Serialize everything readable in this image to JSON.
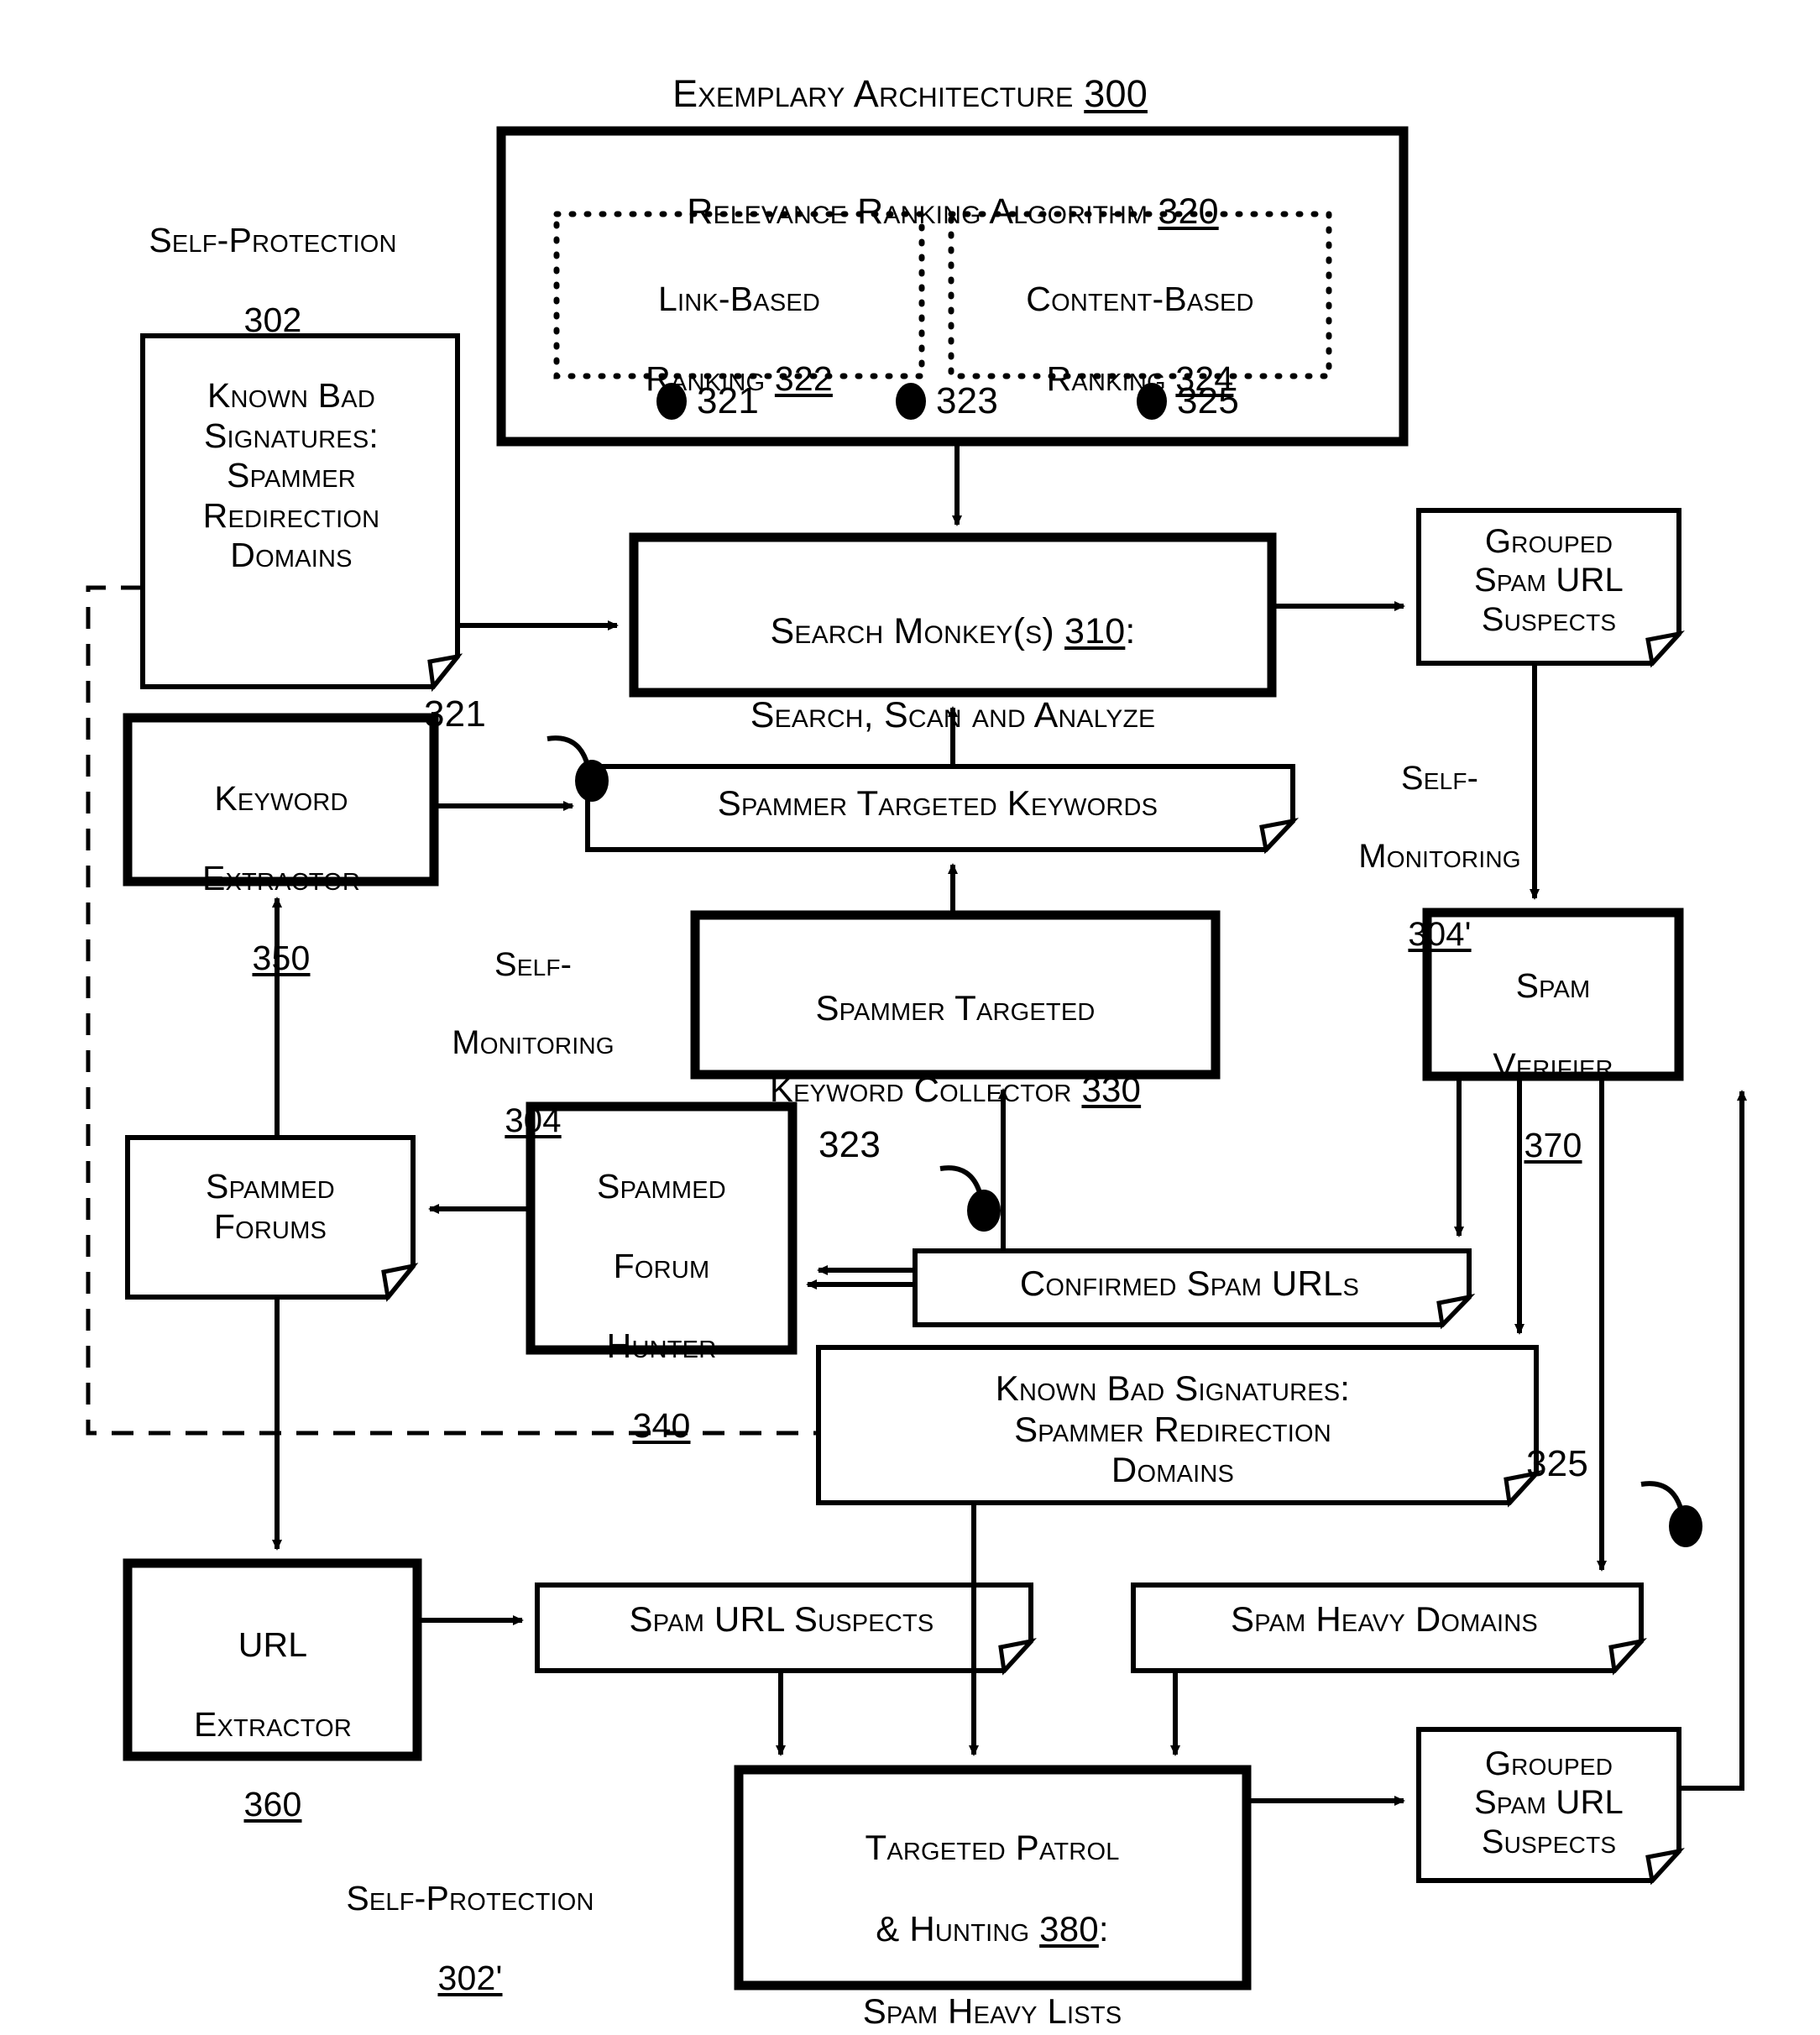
{
  "figure": {
    "title_text": "Exemplary Architecture ",
    "title_ref": "300"
  },
  "annotations": {
    "self_protection_top": {
      "line1": "Self-Protection",
      "ref": "302"
    },
    "self_protection_bottom": {
      "line1": "Self-Protection",
      "ref": "302'"
    },
    "self_monitoring_left": {
      "line1": "Self-",
      "line2": "Monitoring",
      "ref": "304"
    },
    "self_monitoring_right": {
      "line1": "Self-",
      "line2": "Monitoring",
      "ref": "304'"
    },
    "callout_321": "321",
    "callout_323": "323",
    "callout_325": "325"
  },
  "blocks": {
    "relevance_ranking": {
      "title": "Relevance Ranking Algorithm ",
      "ref": "320"
    },
    "link_based": {
      "line1": "Link-Based",
      "line2": "Ranking ",
      "ref": "322"
    },
    "content_based": {
      "line1": "Content-Based",
      "line2": "Ranking ",
      "ref": "324"
    },
    "bullets": [
      {
        "label": "321"
      },
      {
        "label": "323"
      },
      {
        "label": "325"
      }
    ],
    "known_bad_signatures_top": {
      "text": "Known Bad\nSignatures:\nSpammer\nRedirection\nDomains"
    },
    "search_monkey": {
      "line1a": "Search Monkey(s) ",
      "ref": "310",
      "line1b": ":",
      "line2": "Search, Scan and Analyze"
    },
    "grouped_spam_url_suspects_top": {
      "text": "Grouped\nSpam URL\nSuspects"
    },
    "keyword_extractor": {
      "line1": "Keyword",
      "line2": "Extractor",
      "ref": "350"
    },
    "spammer_targeted_keywords": {
      "text": "Spammer Targeted Keywords"
    },
    "spam_verifier": {
      "line1": "Spam",
      "line2": "Verifier",
      "ref": "370"
    },
    "spammer_targeted_keyword_collector": {
      "line1": "Spammer Targeted",
      "line2a": "Keyword Collector ",
      "ref": "330"
    },
    "spammed_forums": {
      "text": "Spammed\nForums"
    },
    "spammed_forum_hunter": {
      "line1": "Spammed",
      "line2": "Forum",
      "line3": "Hunter",
      "ref": "340"
    },
    "confirmed_spam_urls": {
      "text": "Confirmed Spam URLs"
    },
    "known_bad_signatures_bottom": {
      "text": "Known Bad Signatures:\nSpammer Redirection\nDomains"
    },
    "url_extractor": {
      "line1": "URL",
      "line2": "Extractor",
      "ref": "360"
    },
    "spam_url_suspects": {
      "text": "Spam URL Suspects"
    },
    "spam_heavy_domains": {
      "text": "Spam Heavy Domains"
    },
    "targeted_patrol": {
      "line1": "Targeted Patrol",
      "line2a": "& Hunting ",
      "ref": "380",
      "line2b": ":",
      "line3": "Spam Heavy Lists"
    },
    "grouped_spam_url_suspects_bottom": {
      "text": "Grouped\nSpam URL\nSuspects"
    }
  },
  "colors": {
    "ink": "#000000",
    "paper": "#ffffff"
  }
}
